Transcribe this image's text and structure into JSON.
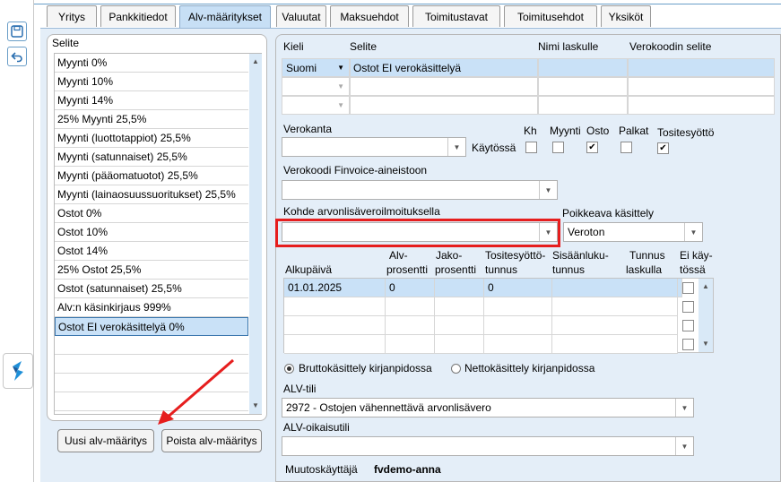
{
  "tabs": [
    "Yritys",
    "Pankkitiedot",
    "Alv-määritykset",
    "Valuutat",
    "Maksuehdot",
    "Toimitustavat",
    "Toimitusehdot",
    "Yksiköt"
  ],
  "active_tab": "Alv-määritykset",
  "left": {
    "header": "Selite",
    "items": [
      "Myynti 0%",
      "Myynti 10%",
      "Myynti 14%",
      "25% Myynti 25,5%",
      "Myynti  (luottotappiot) 25,5%",
      "Myynti  (satunnaiset) 25,5%",
      "Myynti  (pääomatuotot) 25,5%",
      "Myynti  (lainaosuussuoritukset) 25,5%",
      "Ostot 0%",
      "Ostot 10%",
      "Ostot 14%",
      "25% Ostot 25,5%",
      "Ostot  (satunnaiset) 25,5%",
      "Alv:n käsinkirjaus 999%",
      "Ostot EI verokäsittelyä 0%"
    ],
    "selected_index": 14,
    "add_button": "Uusi alv-määritys",
    "delete_button": "Poista alv-määritys"
  },
  "right": {
    "lang_headers": {
      "kieli": "Kieli",
      "selite": "Selite",
      "nimi": "Nimi laskulle",
      "verokoodi": "Verokoodin selite"
    },
    "lang_row": {
      "kieli": "Suomi",
      "selite": "Ostot EI verokäsittelyä"
    },
    "verokanta_label": "Verokanta",
    "kaytossa_label": "Käytössä",
    "flags": {
      "kh": "Kh",
      "myynti": "Myynti",
      "osto": "Osto",
      "palkat": "Palkat",
      "tositesyotto": "Tositesyöttö"
    },
    "finvoice_label": "Verokoodi Finvoice-aineistoon",
    "kohde_label": "Kohde arvonlisäveroilmoituksella",
    "poikkeava_label": "Poikkeava käsittely",
    "poikkeava_value": "Veroton",
    "grid_headers": {
      "alkupaiva": "Alkupäivä",
      "alv1": "Alv-",
      "alv2": "prosentti",
      "jako1": "Jako-",
      "jako2": "prosentti",
      "tos1": "Tositesyöttö-",
      "tos2": "tunnus",
      "sis1": "Sisäänluku-",
      "sis2": "tunnus",
      "tun1": "Tunnus",
      "tun2": "laskulla",
      "ei1": "Ei käy-",
      "ei2": "tössä"
    },
    "grid_row": {
      "alkupaiva": "01.01.2025",
      "alv": "0",
      "tos": "0"
    },
    "brutto_label": "Bruttokäsittely kirjanpidossa",
    "netto_label": "Nettokäsittely kirjanpidossa",
    "alvtili_label": "ALV-tili",
    "alvtili_value": "2972 - Ostojen vähennettävä arvonlisävero",
    "oikaisu_label": "ALV-oikaisutili",
    "muutos_label": "Muutoskäyttäjä",
    "muutos_value": "fvdemo-anna"
  },
  "colors": {
    "accent": "#c9e1f7",
    "highlight": "#e61e1e",
    "panel": "#e4eef8"
  }
}
